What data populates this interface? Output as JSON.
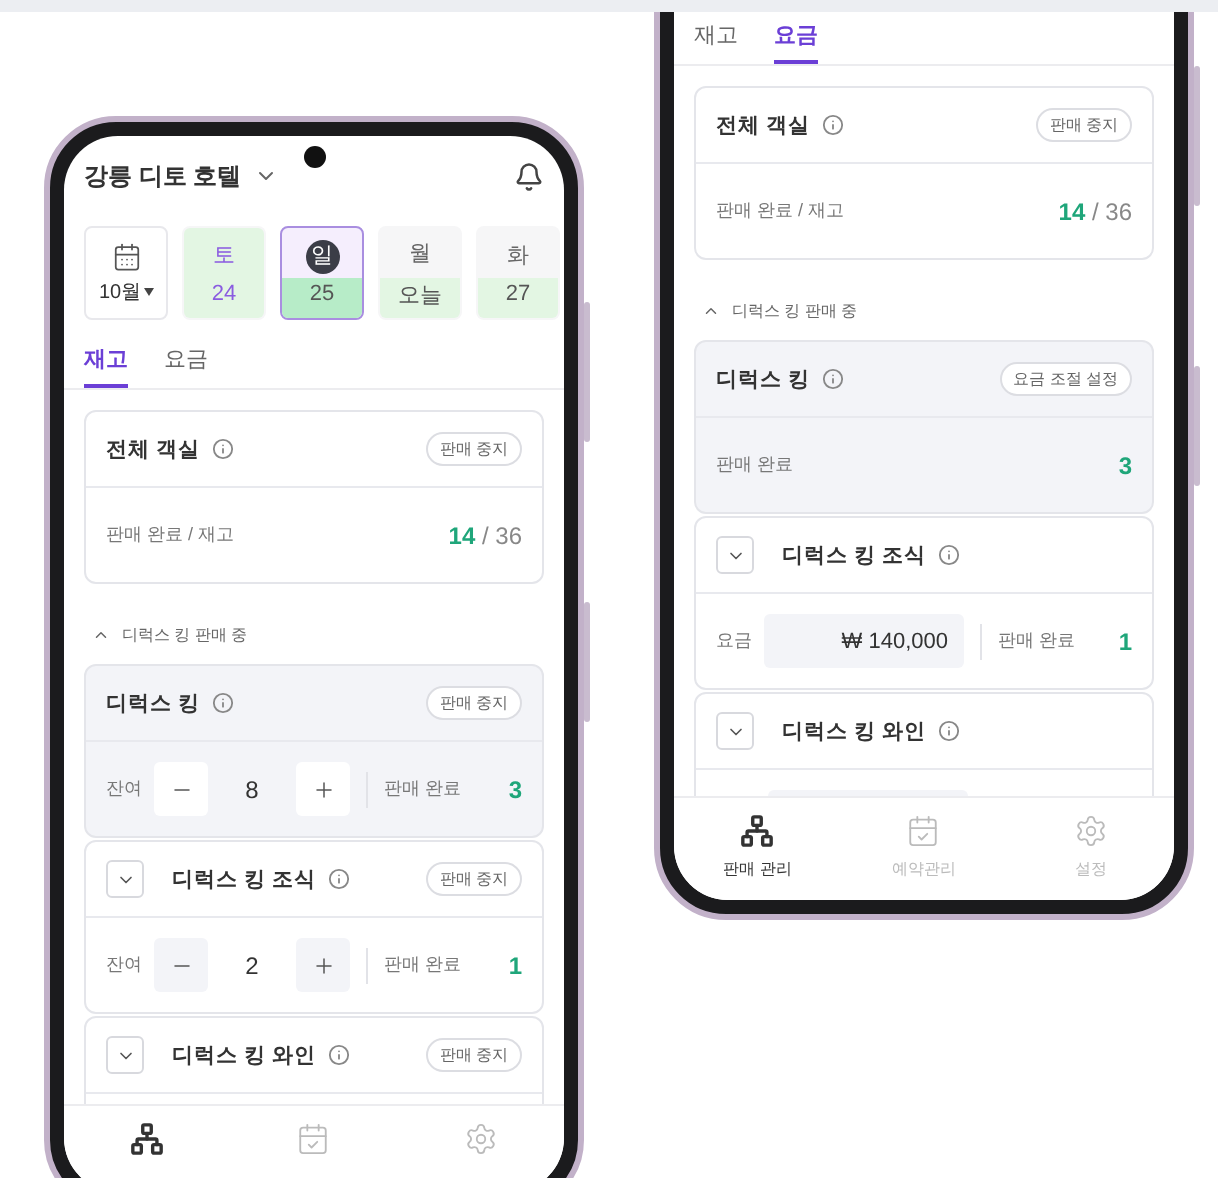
{
  "phones": [
    {
      "header": {
        "title": "강릉 디토 호텔"
      },
      "month": "10월",
      "days": [
        {
          "weekday": "토",
          "date": "24",
          "kind": "saturday",
          "level": 1,
          "selected": false
        },
        {
          "weekday": "일",
          "date": "25",
          "kind": "sunday",
          "level": 0.45,
          "selected": true
        },
        {
          "weekday": "월",
          "date": "오늘",
          "kind": "weekday",
          "level": 0.45,
          "selected": false
        },
        {
          "weekday": "화",
          "date": "27",
          "kind": "weekday",
          "level": 0.45,
          "selected": false
        }
      ],
      "tabs": [
        {
          "label": "재고",
          "selected": true
        },
        {
          "label": "요금",
          "selected": false
        }
      ],
      "summary": {
        "title": "전체 객실",
        "button": "판매 중지",
        "label": "판매 완료 / 재고",
        "sold": "14",
        "rest": "/ 36"
      },
      "section": {
        "label": "디럭스 킹 판매 중",
        "expanded": true
      },
      "rooms": [
        {
          "name": "디럭스 킹",
          "toggle": false,
          "highlighted": true,
          "button": "판매 중지",
          "row": {
            "kind": "stock",
            "label": "잔여",
            "count": "8",
            "sold_label": "판매 완료",
            "sold": "3"
          }
        },
        {
          "name": "디럭스 킹 조식",
          "toggle": true,
          "highlighted": false,
          "button": "판매 중지",
          "row": {
            "kind": "stock",
            "label": "잔여",
            "count": "2",
            "sold_label": "판매 완료",
            "sold": "1"
          }
        },
        {
          "name": "디럭스 킹 와인",
          "toggle": true,
          "highlighted": false,
          "button": "판매 중지",
          "row": {
            "kind": "stockcovered"
          }
        }
      ],
      "nav": [
        {
          "kind": "sitemap",
          "selected": true
        },
        {
          "kind": "calendar",
          "selected": false
        },
        {
          "kind": "settings",
          "selected": false
        }
      ]
    },
    {
      "tabs": [
        {
          "label": "재고",
          "selected": false
        },
        {
          "label": "요금",
          "selected": true
        }
      ],
      "summary": {
        "title": "전체 객실",
        "button": "판매 중지",
        "label": "판매 완료 / 재고",
        "sold": "14",
        "rest": "/ 36"
      },
      "section": {
        "label": "디럭스 킹 판매 중",
        "expanded": true
      },
      "rooms": [
        {
          "name": "디럭스 킹",
          "toggle": false,
          "highlighted": true,
          "button": "요금 조절 설정",
          "row": {
            "kind": "sold",
            "sold_label": "판매 완료",
            "sold": "3"
          }
        },
        {
          "name": "디럭스 킹 조식",
          "toggle": true,
          "highlighted": false,
          "row": {
            "kind": "price",
            "label": "요금",
            "price": "₩ 140,000",
            "sold_label": "판매 완료",
            "sold": "1"
          }
        },
        {
          "name": "디럭스 킹 와인",
          "toggle": true,
          "highlighted": false,
          "row": {
            "kind": "pricecovered"
          }
        }
      ],
      "nav": [
        {
          "kind": "sitemap",
          "label": "판매 관리",
          "selected": true
        },
        {
          "kind": "calendar",
          "label": "예약관리",
          "selected": false
        },
        {
          "kind": "settings",
          "label": "설정",
          "selected": false
        }
      ]
    }
  ]
}
